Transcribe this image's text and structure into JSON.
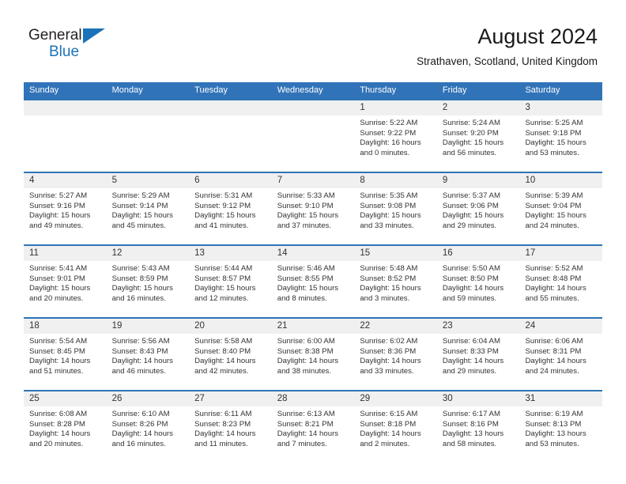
{
  "brand": {
    "name_part1": "General",
    "name_part2": "Blue",
    "triangle_icon": "triangle-icon",
    "accent_color": "#1b72b8"
  },
  "header": {
    "title": "August 2024",
    "subtitle": "Strathaven, Scotland, United Kingdom"
  },
  "colors": {
    "header_blue": "#3173b8",
    "week_divider": "#2e74b5",
    "daynum_band": "#f0f0f0",
    "text": "#333333"
  },
  "calendar": {
    "weekdays": [
      "Sunday",
      "Monday",
      "Tuesday",
      "Wednesday",
      "Thursday",
      "Friday",
      "Saturday"
    ],
    "weeks": [
      [
        {
          "day": "",
          "sunrise": "",
          "sunset": "",
          "daylight1": "",
          "daylight2": ""
        },
        {
          "day": "",
          "sunrise": "",
          "sunset": "",
          "daylight1": "",
          "daylight2": ""
        },
        {
          "day": "",
          "sunrise": "",
          "sunset": "",
          "daylight1": "",
          "daylight2": ""
        },
        {
          "day": "",
          "sunrise": "",
          "sunset": "",
          "daylight1": "",
          "daylight2": ""
        },
        {
          "day": "1",
          "sunrise": "Sunrise: 5:22 AM",
          "sunset": "Sunset: 9:22 PM",
          "daylight1": "Daylight: 16 hours",
          "daylight2": "and 0 minutes."
        },
        {
          "day": "2",
          "sunrise": "Sunrise: 5:24 AM",
          "sunset": "Sunset: 9:20 PM",
          "daylight1": "Daylight: 15 hours",
          "daylight2": "and 56 minutes."
        },
        {
          "day": "3",
          "sunrise": "Sunrise: 5:25 AM",
          "sunset": "Sunset: 9:18 PM",
          "daylight1": "Daylight: 15 hours",
          "daylight2": "and 53 minutes."
        }
      ],
      [
        {
          "day": "4",
          "sunrise": "Sunrise: 5:27 AM",
          "sunset": "Sunset: 9:16 PM",
          "daylight1": "Daylight: 15 hours",
          "daylight2": "and 49 minutes."
        },
        {
          "day": "5",
          "sunrise": "Sunrise: 5:29 AM",
          "sunset": "Sunset: 9:14 PM",
          "daylight1": "Daylight: 15 hours",
          "daylight2": "and 45 minutes."
        },
        {
          "day": "6",
          "sunrise": "Sunrise: 5:31 AM",
          "sunset": "Sunset: 9:12 PM",
          "daylight1": "Daylight: 15 hours",
          "daylight2": "and 41 minutes."
        },
        {
          "day": "7",
          "sunrise": "Sunrise: 5:33 AM",
          "sunset": "Sunset: 9:10 PM",
          "daylight1": "Daylight: 15 hours",
          "daylight2": "and 37 minutes."
        },
        {
          "day": "8",
          "sunrise": "Sunrise: 5:35 AM",
          "sunset": "Sunset: 9:08 PM",
          "daylight1": "Daylight: 15 hours",
          "daylight2": "and 33 minutes."
        },
        {
          "day": "9",
          "sunrise": "Sunrise: 5:37 AM",
          "sunset": "Sunset: 9:06 PM",
          "daylight1": "Daylight: 15 hours",
          "daylight2": "and 29 minutes."
        },
        {
          "day": "10",
          "sunrise": "Sunrise: 5:39 AM",
          "sunset": "Sunset: 9:04 PM",
          "daylight1": "Daylight: 15 hours",
          "daylight2": "and 24 minutes."
        }
      ],
      [
        {
          "day": "11",
          "sunrise": "Sunrise: 5:41 AM",
          "sunset": "Sunset: 9:01 PM",
          "daylight1": "Daylight: 15 hours",
          "daylight2": "and 20 minutes."
        },
        {
          "day": "12",
          "sunrise": "Sunrise: 5:43 AM",
          "sunset": "Sunset: 8:59 PM",
          "daylight1": "Daylight: 15 hours",
          "daylight2": "and 16 minutes."
        },
        {
          "day": "13",
          "sunrise": "Sunrise: 5:44 AM",
          "sunset": "Sunset: 8:57 PM",
          "daylight1": "Daylight: 15 hours",
          "daylight2": "and 12 minutes."
        },
        {
          "day": "14",
          "sunrise": "Sunrise: 5:46 AM",
          "sunset": "Sunset: 8:55 PM",
          "daylight1": "Daylight: 15 hours",
          "daylight2": "and 8 minutes."
        },
        {
          "day": "15",
          "sunrise": "Sunrise: 5:48 AM",
          "sunset": "Sunset: 8:52 PM",
          "daylight1": "Daylight: 15 hours",
          "daylight2": "and 3 minutes."
        },
        {
          "day": "16",
          "sunrise": "Sunrise: 5:50 AM",
          "sunset": "Sunset: 8:50 PM",
          "daylight1": "Daylight: 14 hours",
          "daylight2": "and 59 minutes."
        },
        {
          "day": "17",
          "sunrise": "Sunrise: 5:52 AM",
          "sunset": "Sunset: 8:48 PM",
          "daylight1": "Daylight: 14 hours",
          "daylight2": "and 55 minutes."
        }
      ],
      [
        {
          "day": "18",
          "sunrise": "Sunrise: 5:54 AM",
          "sunset": "Sunset: 8:45 PM",
          "daylight1": "Daylight: 14 hours",
          "daylight2": "and 51 minutes."
        },
        {
          "day": "19",
          "sunrise": "Sunrise: 5:56 AM",
          "sunset": "Sunset: 8:43 PM",
          "daylight1": "Daylight: 14 hours",
          "daylight2": "and 46 minutes."
        },
        {
          "day": "20",
          "sunrise": "Sunrise: 5:58 AM",
          "sunset": "Sunset: 8:40 PM",
          "daylight1": "Daylight: 14 hours",
          "daylight2": "and 42 minutes."
        },
        {
          "day": "21",
          "sunrise": "Sunrise: 6:00 AM",
          "sunset": "Sunset: 8:38 PM",
          "daylight1": "Daylight: 14 hours",
          "daylight2": "and 38 minutes."
        },
        {
          "day": "22",
          "sunrise": "Sunrise: 6:02 AM",
          "sunset": "Sunset: 8:36 PM",
          "daylight1": "Daylight: 14 hours",
          "daylight2": "and 33 minutes."
        },
        {
          "day": "23",
          "sunrise": "Sunrise: 6:04 AM",
          "sunset": "Sunset: 8:33 PM",
          "daylight1": "Daylight: 14 hours",
          "daylight2": "and 29 minutes."
        },
        {
          "day": "24",
          "sunrise": "Sunrise: 6:06 AM",
          "sunset": "Sunset: 8:31 PM",
          "daylight1": "Daylight: 14 hours",
          "daylight2": "and 24 minutes."
        }
      ],
      [
        {
          "day": "25",
          "sunrise": "Sunrise: 6:08 AM",
          "sunset": "Sunset: 8:28 PM",
          "daylight1": "Daylight: 14 hours",
          "daylight2": "and 20 minutes."
        },
        {
          "day": "26",
          "sunrise": "Sunrise: 6:10 AM",
          "sunset": "Sunset: 8:26 PM",
          "daylight1": "Daylight: 14 hours",
          "daylight2": "and 16 minutes."
        },
        {
          "day": "27",
          "sunrise": "Sunrise: 6:11 AM",
          "sunset": "Sunset: 8:23 PM",
          "daylight1": "Daylight: 14 hours",
          "daylight2": "and 11 minutes."
        },
        {
          "day": "28",
          "sunrise": "Sunrise: 6:13 AM",
          "sunset": "Sunset: 8:21 PM",
          "daylight1": "Daylight: 14 hours",
          "daylight2": "and 7 minutes."
        },
        {
          "day": "29",
          "sunrise": "Sunrise: 6:15 AM",
          "sunset": "Sunset: 8:18 PM",
          "daylight1": "Daylight: 14 hours",
          "daylight2": "and 2 minutes."
        },
        {
          "day": "30",
          "sunrise": "Sunrise: 6:17 AM",
          "sunset": "Sunset: 8:16 PM",
          "daylight1": "Daylight: 13 hours",
          "daylight2": "and 58 minutes."
        },
        {
          "day": "31",
          "sunrise": "Sunrise: 6:19 AM",
          "sunset": "Sunset: 8:13 PM",
          "daylight1": "Daylight: 13 hours",
          "daylight2": "and 53 minutes."
        }
      ]
    ]
  }
}
